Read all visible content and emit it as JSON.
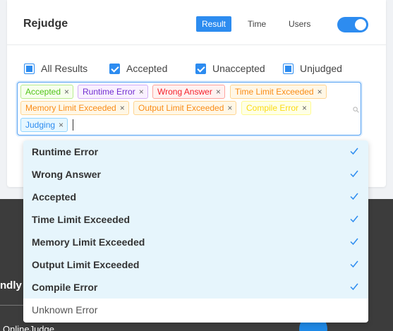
{
  "footer": {
    "text_1": "ndly",
    "text_2": "OnlineJudge"
  },
  "card": {
    "title": "Rejudge",
    "segments": [
      {
        "label": "Result",
        "active": true
      },
      {
        "label": "Time",
        "active": false
      },
      {
        "label": "Users",
        "active": false
      }
    ],
    "toggle_on": true
  },
  "filters": [
    {
      "label": "All Results",
      "state": "indeterminate"
    },
    {
      "label": "Accepted",
      "state": "checked"
    },
    {
      "label": "Unaccepted",
      "state": "checked"
    },
    {
      "label": "Unjudged",
      "state": "indeterminate"
    }
  ],
  "tags": [
    {
      "label": "Accepted",
      "color": "#52c41a",
      "bg": "#f6ffed",
      "border": "#b7eb8f"
    },
    {
      "label": "Runtime Error",
      "color": "#722ed1",
      "bg": "#f9f0ff",
      "border": "#d3adf7"
    },
    {
      "label": "Wrong Answer",
      "color": "#f5222d",
      "bg": "#fff1f0",
      "border": "#ffa39e"
    },
    {
      "label": "Time Limit Exceeded",
      "color": "#fa8c16",
      "bg": "#fff7e6",
      "border": "#ffd591"
    },
    {
      "label": "Memory Limit Exceeded",
      "color": "#fa8c16",
      "bg": "#fff7e6",
      "border": "#ffd591"
    },
    {
      "label": "Output Limit Exceeded",
      "color": "#fa8c16",
      "bg": "#fff7e6",
      "border": "#ffd591"
    },
    {
      "label": "Compile Error",
      "color": "#fadb14",
      "bg": "#feffe6",
      "border": "#fffb8f"
    },
    {
      "label": "Judging",
      "color": "#2d8cf0",
      "bg": "#e6f7ff",
      "border": "#91d5ff"
    }
  ],
  "tag_close_glyph": "×",
  "dropdown": [
    {
      "label": "Runtime Error",
      "selected": true
    },
    {
      "label": "Wrong Answer",
      "selected": true
    },
    {
      "label": "Accepted",
      "selected": true
    },
    {
      "label": "Time Limit Exceeded",
      "selected": true
    },
    {
      "label": "Memory Limit Exceeded",
      "selected": true
    },
    {
      "label": "Output Limit Exceeded",
      "selected": true
    },
    {
      "label": "Compile Error",
      "selected": true
    },
    {
      "label": "Unknown Error",
      "selected": false
    }
  ],
  "icons": {
    "search": "search-icon",
    "check": "check-icon"
  },
  "colors": {
    "accent": "#2d8cf0",
    "dropdown_selected_bg": "#e6f5fc"
  }
}
